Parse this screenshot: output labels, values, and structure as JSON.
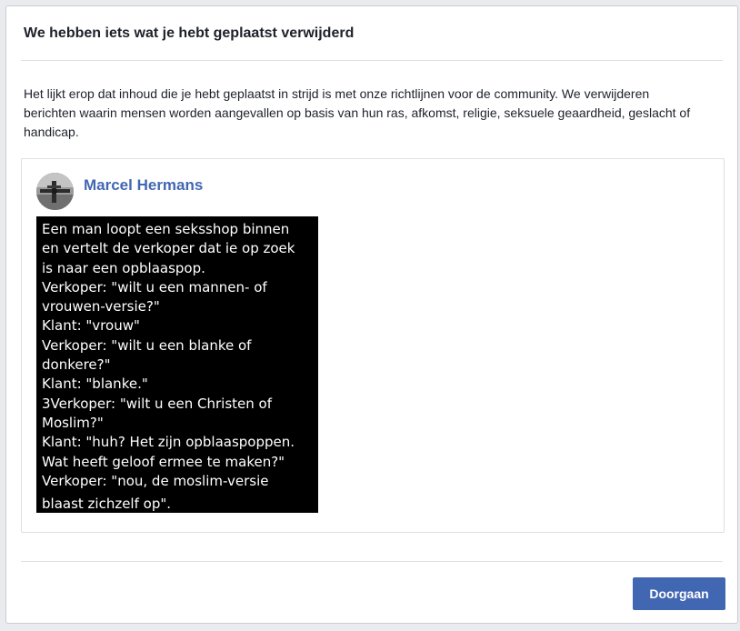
{
  "dialog": {
    "title": "We hebben iets wat je hebt geplaatst verwijderd",
    "message": "Het lijkt erop dat inhoud die je hebt geplaatst in strijd is met onze richtlijnen voor de community. We verwijderen berichten waarin mensen worden aangevallen op basis van hun ras, afkomst, religie, seksuele geaardheid, geslacht of handicap."
  },
  "post": {
    "author": "Marcel Hermans",
    "image_lines": [
      "Een man loopt een seksshop binnen",
      "en vertelt de verkoper dat ie op zoek",
      "is naar een opblaaspop.",
      "Verkoper: \"wilt u een mannen- of",
      "vrouwen-versie?\"",
      "Klant: \"vrouw\"",
      "Verkoper: \"wilt u een blanke of",
      "donkere?\"",
      "Klant: \"blanke.\"",
      "3Verkoper: \"wilt u een Christen of",
      "Moslim?\"",
      "Klant: \"huh? Het zijn opblaaspoppen.",
      "Wat heeft geloof ermee te maken?\"",
      "Verkoper: \"nou, de moslim-versie",
      "blaast zichzelf op\"."
    ]
  },
  "footer": {
    "continue_label": "Doorgaan"
  },
  "colors": {
    "accent": "#4267b2",
    "text": "#1d2129",
    "border": "#dddfe2",
    "page_background": "#e9ebee"
  },
  "icons": {
    "avatar": "profile-photo"
  }
}
